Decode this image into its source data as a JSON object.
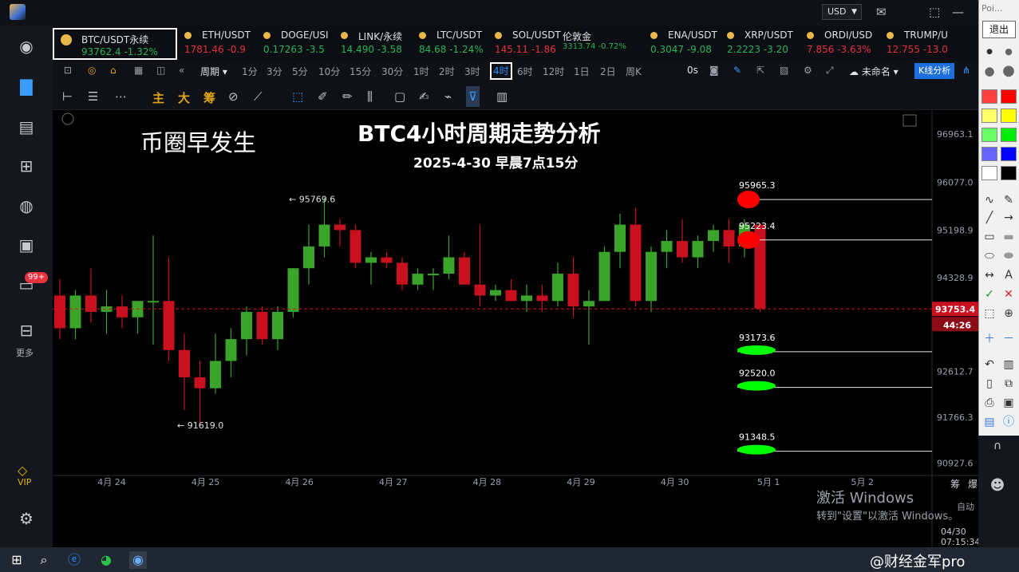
{
  "titlebar": {
    "currency": "USD",
    "icons": [
      "mail-icon",
      "fullscreen-icon",
      "minimize-icon",
      "close-icon"
    ]
  },
  "sidebar": {
    "badge": "99+",
    "more_label": "更多",
    "vip_label": "VIP"
  },
  "tickers": [
    {
      "symbol": "BTC/USDT永续",
      "price": "93762.4",
      "change": "-1.32%",
      "dir": "up"
    },
    {
      "symbol": "ETH/USDT",
      "price": "1781.46",
      "change": "-0.9",
      "dir": "down"
    },
    {
      "symbol": "DOGE/USI",
      "price": "0.17263",
      "change": "-3.5",
      "dir": "up"
    },
    {
      "symbol": "LINK/永续",
      "price": "14.490",
      "change": "-3.58",
      "dir": "up"
    },
    {
      "symbol": "LTC/USDT",
      "price": "84.68",
      "change": "-1.24%",
      "dir": "up"
    },
    {
      "symbol": "SOL/USDT",
      "price": "145.11",
      "change": "-1.86",
      "dir": "down"
    },
    {
      "symbol": "伦敦金",
      "price": "3313.74",
      "change": "-0.72%",
      "dir": "up"
    },
    {
      "symbol": "ENA/USDT",
      "price": "0.3047",
      "change": "-9.08",
      "dir": "up"
    },
    {
      "symbol": "XRP/USDT",
      "price": "2.2223",
      "change": "-3.20",
      "dir": "up"
    },
    {
      "symbol": "ORDI/USD",
      "price": "7.856",
      "change": "-3.63%",
      "dir": "down"
    },
    {
      "symbol": "TRUMP/U",
      "price": "12.755",
      "change": "-13.0",
      "dir": "down"
    }
  ],
  "toolbar1": {
    "period_label": "周期",
    "timeframes": [
      "1分",
      "3分",
      "5分",
      "10分",
      "15分",
      "30分",
      "1时",
      "2时",
      "3时",
      "4时",
      "6时",
      "12时",
      "1日",
      "2日",
      "周K"
    ],
    "active_timeframe": "4时",
    "countdown": "0s",
    "layout_name": "未命名",
    "kline_button": "K线分析"
  },
  "toolbar2": {
    "tools": [
      "主",
      "大",
      "筹"
    ]
  },
  "chart": {
    "watermark": "币圈早发生",
    "title": "BTC4小时周期走势分析",
    "subtitle": "2025-4-30  早晨7点15分",
    "activate_line1": "激活 Windows",
    "activate_line2": "转到\"设置\"以激活 Windows。",
    "auto_label": "自动",
    "datetime_label": "04/30 07:15:34",
    "corner_labels": [
      "筹",
      "爆"
    ]
  },
  "chart_data": {
    "type": "candlestick",
    "x_ticks": [
      "4月 24",
      "4月 25",
      "4月 26",
      "4月 27",
      "4月 28",
      "4月 29",
      "4月 30",
      "5月 1",
      "5月 2"
    ],
    "y_ticks": [
      96963.1,
      96077.0,
      95198.9,
      94328.9,
      92612.7,
      91766.3,
      90927.6
    ],
    "ylim": [
      90700,
      97400
    ],
    "last_price": "93753.4",
    "bar_countdown": "44:26",
    "high_label": "95769.6",
    "low_label": "91619.0",
    "resistance_levels": [
      95965.3,
      95223.4
    ],
    "support_levels": [
      93173.6,
      92520.0,
      91348.5
    ],
    "candles": [
      [
        94000,
        94300,
        93200,
        93400
      ],
      [
        93400,
        94100,
        93200,
        94000
      ],
      [
        94000,
        94500,
        93500,
        93700
      ],
      [
        93700,
        94100,
        93300,
        93800
      ],
      [
        93800,
        94000,
        93400,
        93600
      ],
      [
        93600,
        93900,
        93300,
        93900
      ],
      [
        93900,
        95100,
        93100,
        93900
      ],
      [
        93900,
        94700,
        92800,
        93000
      ],
      [
        93000,
        93300,
        91900,
        92500
      ],
      [
        92500,
        92800,
        91600,
        92300
      ],
      [
        92300,
        93300,
        92200,
        92800
      ],
      [
        92800,
        93400,
        92500,
        93200
      ],
      [
        93200,
        93800,
        92900,
        93700
      ],
      [
        93700,
        93800,
        93100,
        93200
      ],
      [
        93200,
        93800,
        93000,
        93700
      ],
      [
        93700,
        94500,
        93600,
        94500
      ],
      [
        94500,
        95300,
        94200,
        94900
      ],
      [
        94900,
        95800,
        94700,
        95300
      ],
      [
        95300,
        95400,
        94900,
        95200
      ],
      [
        95200,
        95300,
        94500,
        94600
      ],
      [
        94600,
        94800,
        94200,
        94700
      ],
      [
        94700,
        94800,
        94500,
        94600
      ],
      [
        94600,
        94700,
        94100,
        94200
      ],
      [
        94200,
        94500,
        94100,
        94400
      ],
      [
        94400,
        94500,
        94100,
        94400
      ],
      [
        94400,
        95100,
        94300,
        94700
      ],
      [
        94700,
        94800,
        94200,
        94200
      ],
      [
        94200,
        95300,
        93800,
        94000
      ],
      [
        94000,
        94200,
        93900,
        94100
      ],
      [
        94100,
        94300,
        93900,
        93900
      ],
      [
        93900,
        94200,
        93700,
        94000
      ],
      [
        94000,
        94200,
        93700,
        93900
      ],
      [
        93900,
        94600,
        93800,
        94400
      ],
      [
        94400,
        94700,
        93600,
        93800
      ],
      [
        93800,
        94100,
        93100,
        93900
      ],
      [
        93900,
        94900,
        93900,
        94800
      ],
      [
        94800,
        95500,
        94500,
        95300
      ],
      [
        95300,
        95600,
        93800,
        93900
      ],
      [
        93900,
        94900,
        93700,
        94800
      ],
      [
        94800,
        95200,
        94500,
        95000
      ],
      [
        95000,
        95400,
        94600,
        94700
      ],
      [
        94700,
        95100,
        94500,
        95000
      ],
      [
        95000,
        95300,
        94800,
        95200
      ],
      [
        95200,
        95400,
        94600,
        94900
      ],
      [
        94900,
        95400,
        94700,
        95300
      ],
      [
        95300,
        95300,
        93700,
        93760
      ]
    ]
  },
  "draw_panel": {
    "title": "Poi...",
    "exit_label": "退出",
    "swatches": [
      "#ff4040",
      "#ff0000",
      "#ffff66",
      "#ffff00",
      "#66ff66",
      "#00ee00",
      "#6666ff",
      "#0000ff",
      "#ffffff",
      "#000000"
    ]
  },
  "overlay_brand": "@财经金军pro"
}
